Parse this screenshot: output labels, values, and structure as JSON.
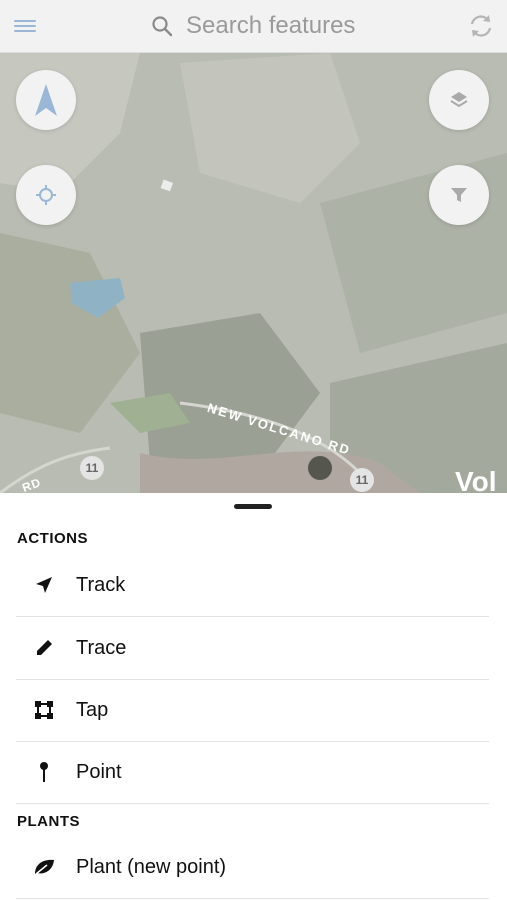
{
  "header": {
    "search_placeholder": "Search features",
    "icons": {
      "menu": "hamburger-menu-icon",
      "search": "search-icon",
      "sync": "sync-icon"
    }
  },
  "map": {
    "road_label": "NEW VOLCANO RD",
    "road_label_left": "RD",
    "route_shields": [
      "11",
      "11"
    ],
    "place_label_partial": "Vol",
    "buttons": [
      "north-arrow",
      "my-location",
      "layers",
      "filter"
    ]
  },
  "sheet": {
    "actions_heading": "ACTIONS",
    "actions": [
      {
        "label": "Track",
        "icon": "navigation-arrow-icon"
      },
      {
        "label": "Trace",
        "icon": "pencil-icon"
      },
      {
        "label": "Tap",
        "icon": "polygon-vertices-icon"
      },
      {
        "label": "Point",
        "icon": "pin-icon"
      }
    ],
    "plants_heading": "PLANTS",
    "plants": [
      {
        "label": "Plant (new point)",
        "icon": "leaf-icon"
      }
    ]
  },
  "colors": {
    "accent": "#9bb7d8",
    "topbar": "#f2f2f2",
    "divider": "#e2e2e2"
  }
}
